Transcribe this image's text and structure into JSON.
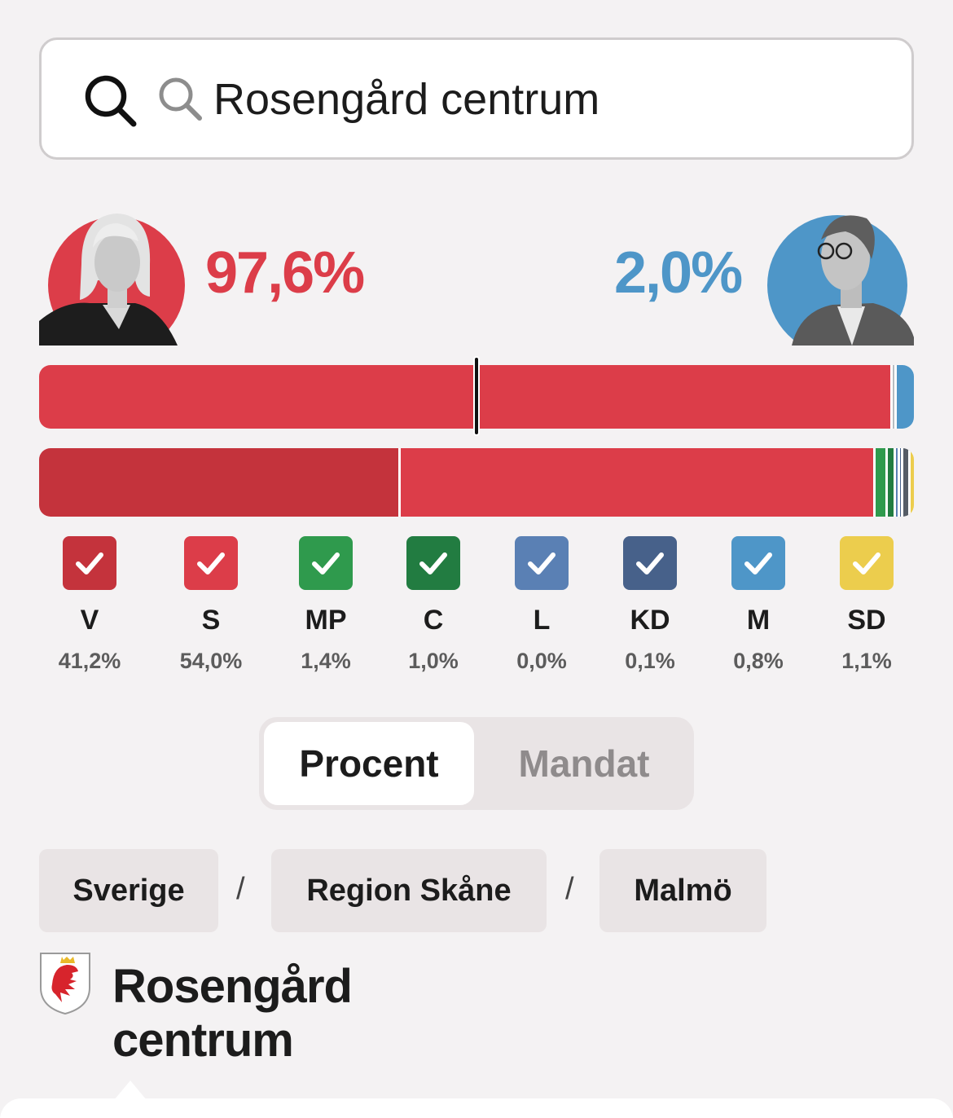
{
  "search": {
    "placeholder": "Rosengård centrum",
    "value": "Rosengård centrum"
  },
  "leaders": {
    "left": {
      "percent": "97,6%",
      "color": "#dc3d49"
    },
    "right": {
      "percent": "2,0%",
      "color": "#4e96c8"
    }
  },
  "bloc_bar": [
    {
      "share": 97.6,
      "color": "#dc3d49"
    },
    {
      "share": 0.4,
      "color": "#b7bdc2"
    },
    {
      "share": 2.0,
      "color": "#4e96c8"
    }
  ],
  "party_bar": [
    {
      "party": "V",
      "share": 41.2,
      "color": "#c4333c"
    },
    {
      "party": "S",
      "share": 54.0,
      "color": "#dc3d49"
    },
    {
      "party": "MP",
      "share": 1.4,
      "color": "#2f9a4d"
    },
    {
      "party": "C",
      "share": 1.0,
      "color": "#227c41"
    },
    {
      "party": "L",
      "share": 0.0,
      "color": "#5a80b4"
    },
    {
      "party": "KD",
      "share": 0.1,
      "color": "#47618a"
    },
    {
      "party": "M",
      "share": 0.8,
      "color": "#565d66"
    },
    {
      "party": "SD",
      "share": 1.1,
      "color": "#eccd4d"
    }
  ],
  "parties": [
    {
      "abbr": "V",
      "percent": "41,2%",
      "color": "#c4333c"
    },
    {
      "abbr": "S",
      "percent": "54,0%",
      "color": "#dc3d49"
    },
    {
      "abbr": "MP",
      "percent": "1,4%",
      "color": "#2f9a4d"
    },
    {
      "abbr": "C",
      "percent": "1,0%",
      "color": "#227c41"
    },
    {
      "abbr": "L",
      "percent": "0,0%",
      "color": "#5a80b4"
    },
    {
      "abbr": "KD",
      "percent": "0,1%",
      "color": "#47618a"
    },
    {
      "abbr": "M",
      "percent": "0,8%",
      "color": "#4e96c8"
    },
    {
      "abbr": "SD",
      "percent": "1,1%",
      "color": "#eccd4d"
    }
  ],
  "toggle": {
    "procent": "Procent",
    "mandat": "Mandat",
    "selected": "Procent"
  },
  "breadcrumb": {
    "items": [
      "Sverige",
      "Region Skåne",
      "Malmö"
    ],
    "separator": "/"
  },
  "area": {
    "title_line1": "Rosengård",
    "title_line2": "centrum"
  }
}
